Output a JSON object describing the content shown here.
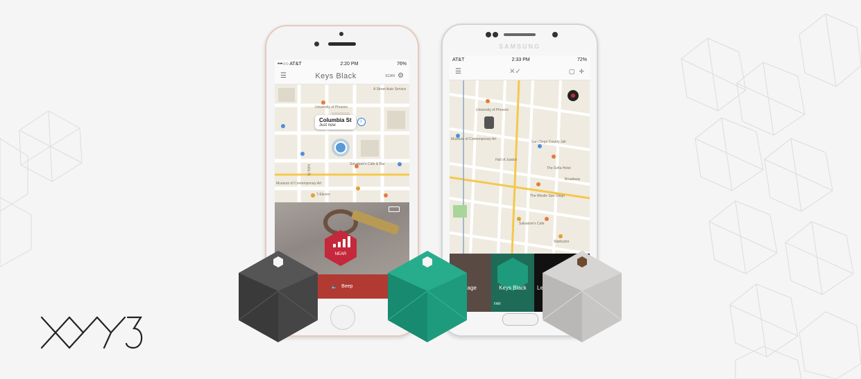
{
  "brand": {
    "logo_text": "XY3"
  },
  "iphone": {
    "carrier": "•••○○ AT&T",
    "time": "2:20 PM",
    "battery": "76%",
    "title": "Keys Black",
    "settings_label": "SCAN",
    "callout": {
      "title": "Columbia St",
      "subtitle": "Just now"
    },
    "map_labels": [
      "University of Phoenix",
      "Museum of Contemporary Art",
      "Salvatore's Cafe & Bar",
      "7-Eleven",
      "India St",
      "A Street Auto Service"
    ],
    "proximity_label": "NEAR",
    "beep_label": "Beep"
  },
  "samsung": {
    "brand": "SAMSUNG",
    "carrier": "AT&T",
    "time": "2:33 PM",
    "battery": "72%",
    "map_labels": [
      "Museum of Contemporary Art",
      "University of Phoenix",
      "Hall of Justice",
      "San Diego County Jail",
      "The Sofia Hotel",
      "Broadway",
      "The Westin San Diego",
      "Salvatore's Cafe",
      "Starbucks"
    ],
    "tiles": [
      "gage",
      "Keys Black",
      "Le"
    ],
    "tile_status": "FAR"
  },
  "colors": {
    "accent": "#1e9b7d",
    "dark_tag": "#454545",
    "light_tag": "#c7c6c4",
    "red_badge": "#c4283a"
  }
}
